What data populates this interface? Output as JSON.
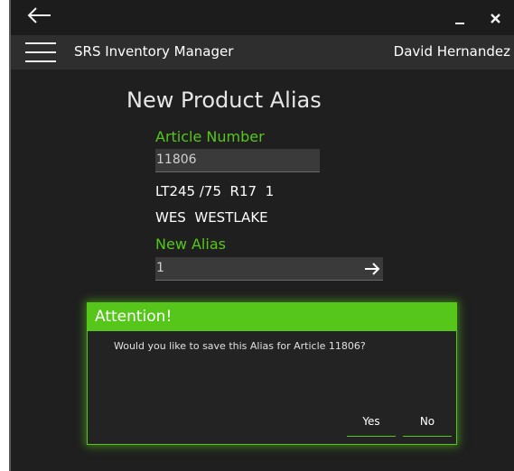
{
  "window": {
    "title_icons": {
      "back": "back-arrow-icon",
      "minimize": "minimize-icon",
      "close": "close-icon"
    }
  },
  "appbar": {
    "menu_icon": "hamburger-menu-icon",
    "title": "SRS Inventory Manager",
    "user": "David Hernandez"
  },
  "form": {
    "title": "New Product Alias",
    "article_label": "Article Number",
    "article_value": "11806",
    "product_line1": "LT245 /75  R17  1",
    "product_line2": "WES  WESTLAKE",
    "alias_label": "New Alias",
    "alias_value": "1",
    "submit_icon": "arrow-right-icon"
  },
  "dialog": {
    "title": "Attention!",
    "message": "Would you like to save this Alias for Article 11806?",
    "yes_label": "Yes",
    "no_label": "No"
  },
  "colors": {
    "accent_green": "#56c71a",
    "background": "#1f1f1f",
    "appbar": "#2e2e2e",
    "field_bg": "#3a3a3a"
  }
}
